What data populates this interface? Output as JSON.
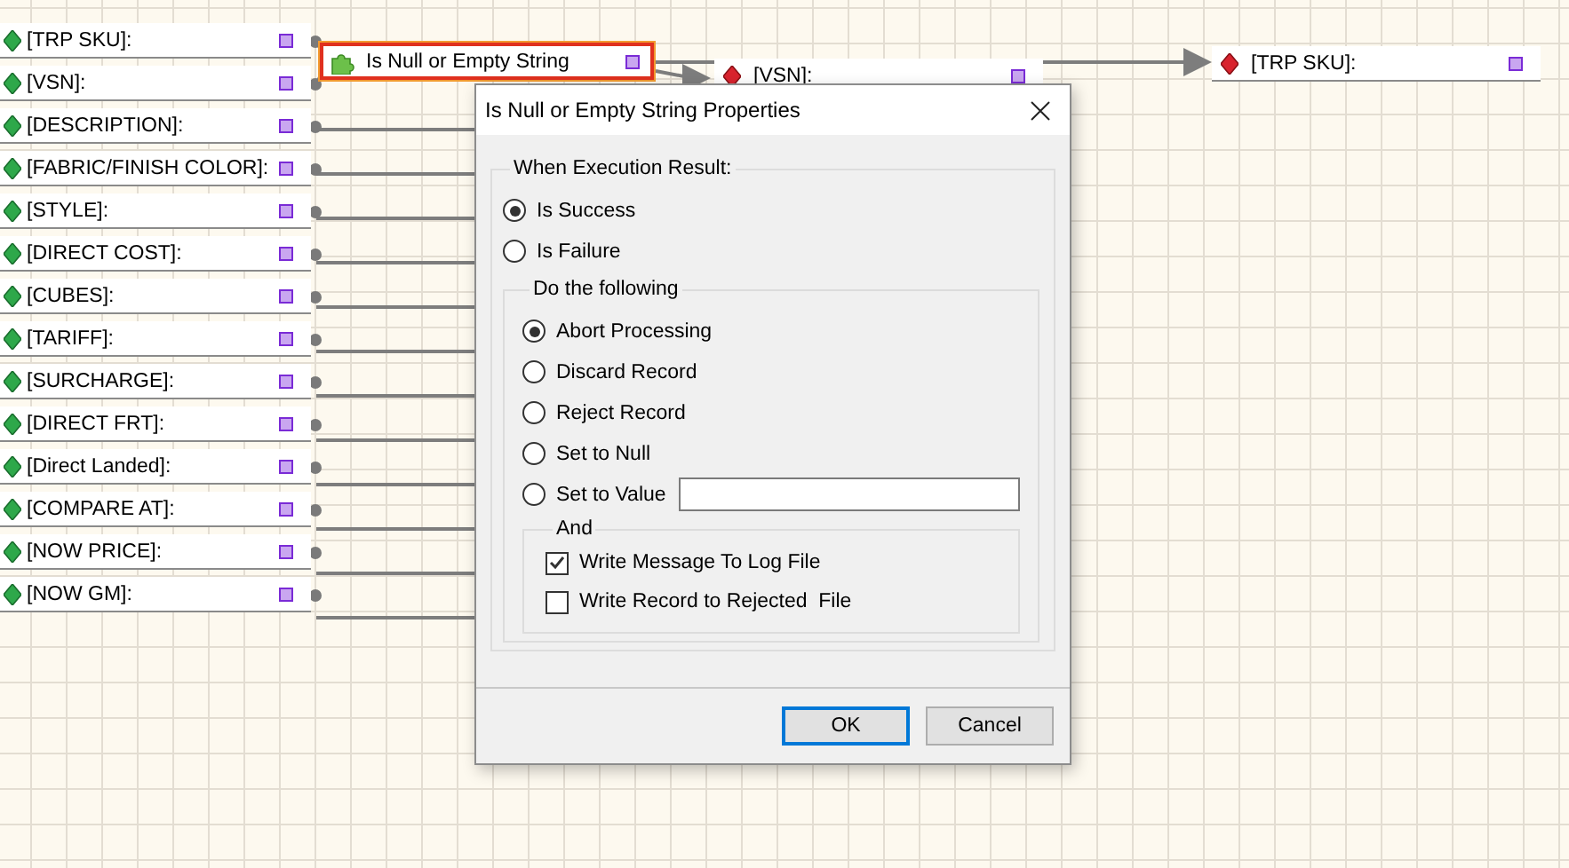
{
  "source_fields": [
    {
      "label": "[TRP SKU]:"
    },
    {
      "label": "[VSN]:"
    },
    {
      "label": "[DESCRIPTION]:"
    },
    {
      "label": "[FABRIC/FINISH COLOR]:"
    },
    {
      "label": "[STYLE]:"
    },
    {
      "label": "[DIRECT COST]:"
    },
    {
      "label": "[CUBES]:"
    },
    {
      "label": "[TARIFF]:"
    },
    {
      "label": "[SURCHARGE]:"
    },
    {
      "label": "[DIRECT FRT]:"
    },
    {
      "label": "[Direct Landed]:"
    },
    {
      "label": "[COMPARE AT]:"
    },
    {
      "label": "[NOW PRICE]:"
    },
    {
      "label": "[NOW GM]:"
    }
  ],
  "function_node": {
    "label": "Is Null or Empty String",
    "selected": true
  },
  "target_fields": [
    {
      "label": "[VSN]:"
    },
    {
      "label": "[TRP SKU]:"
    }
  ],
  "dialog": {
    "title": "Is Null or Empty String Properties",
    "result_group": {
      "label": "When Execution Result:",
      "options": [
        {
          "label": "Is Success",
          "selected": true
        },
        {
          "label": "Is Failure",
          "selected": false
        }
      ]
    },
    "action_group": {
      "label": "Do the following",
      "options": [
        {
          "label": "Abort Processing",
          "selected": true,
          "kind": "plain"
        },
        {
          "label": "Discard Record",
          "selected": false,
          "kind": "plain"
        },
        {
          "label": "Reject Record",
          "selected": false,
          "kind": "plain"
        },
        {
          "label": "Set to Null",
          "selected": false,
          "kind": "plain"
        },
        {
          "label": "Set to Value",
          "selected": false,
          "kind": "with_field"
        }
      ]
    },
    "and_group": {
      "label": "And",
      "options": [
        {
          "label": "Write Message To Log File",
          "checked": true
        },
        {
          "label": "Write Record to Rejected  File",
          "checked": false
        }
      ]
    },
    "buttons": [
      {
        "label": "OK",
        "kind": "default"
      },
      {
        "label": "Cancel",
        "kind": "normal"
      }
    ]
  }
}
